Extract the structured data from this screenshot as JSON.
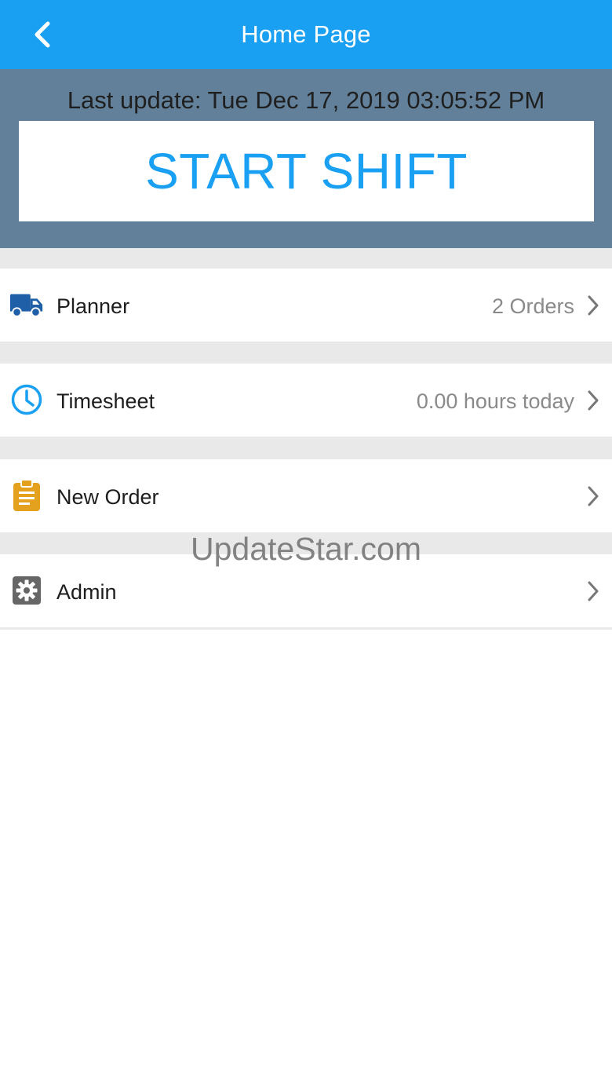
{
  "navbar": {
    "title": "Home Page",
    "back_icon": "chevron-left-icon"
  },
  "hero": {
    "last_update": "Last update: Tue Dec 17, 2019 03:05:52 PM",
    "start_shift_label": "START SHIFT"
  },
  "menu": [
    {
      "label": "Planner",
      "detail": "2 Orders",
      "icon": "truck-icon",
      "icon_color": "#1e5fa8"
    },
    {
      "label": "Timesheet",
      "detail": "0.00 hours today",
      "icon": "clock-icon",
      "icon_color": "#1aa0f2"
    },
    {
      "label": "New Order",
      "detail": "",
      "icon": "clipboard-icon",
      "icon_color": "#e3a11e"
    },
    {
      "label": "Admin",
      "detail": "",
      "icon": "gear-icon",
      "icon_color": "#666666"
    }
  ],
  "watermark": "UpdateStar.com",
  "colors": {
    "accent": "#1aa0f2",
    "header_band": "#62809a",
    "separator": "#e9e9e9"
  }
}
